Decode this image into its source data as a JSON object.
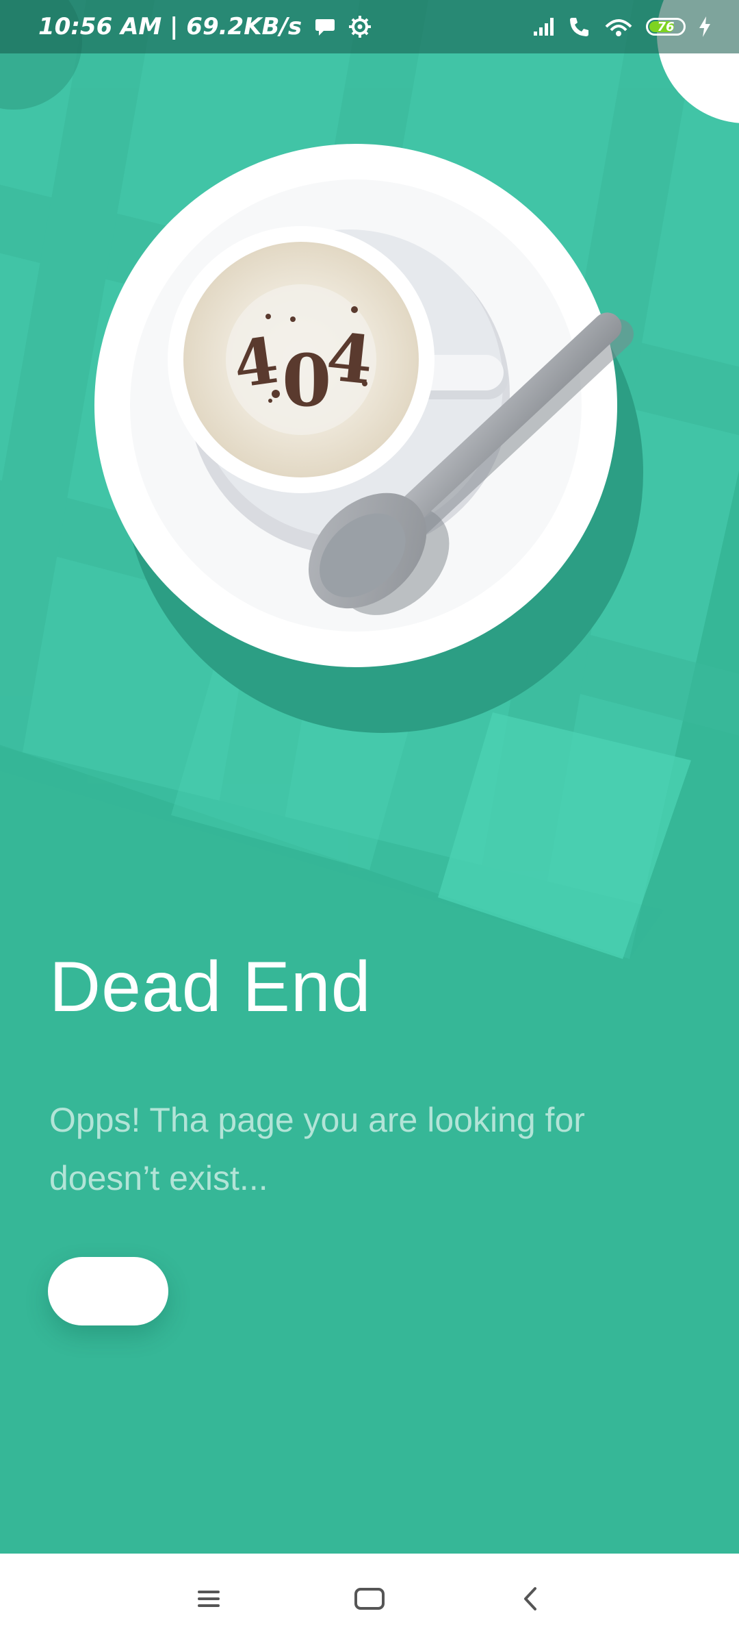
{
  "status_bar": {
    "time_speed": "10:56 AM | 69.2KB/s",
    "battery_level": "76",
    "icons": [
      "chat-bubble-icon",
      "settings-gear-icon",
      "signal-icon",
      "wifi-call-icon",
      "hotspot-icon",
      "battery-icon",
      "charging-icon"
    ]
  },
  "illustration": {
    "latte_art_text": "4.0.4",
    "colors": {
      "background": "#36b797",
      "tablecloth": "#46ccb0",
      "saucer": "#ffffff",
      "coffee": "#e9e2d3",
      "spoon": "#a3a6ab"
    }
  },
  "content": {
    "title": "Dead End",
    "message": "Opps! Tha page you are looking for doesn’t exist...",
    "button_label": ""
  },
  "nav_bar": {
    "buttons": [
      "menu-icon",
      "home-icon",
      "back-icon"
    ]
  }
}
